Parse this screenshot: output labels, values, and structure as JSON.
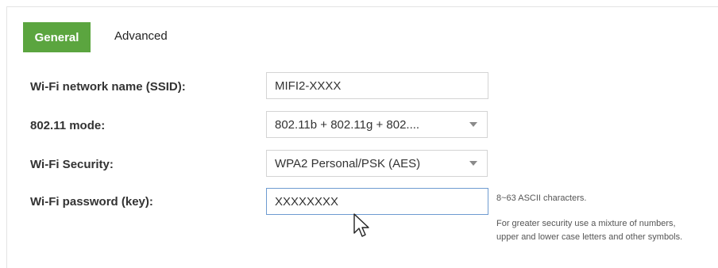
{
  "tabs": {
    "general": "General",
    "advanced": "Advanced"
  },
  "fields": {
    "ssid": {
      "label": "Wi-Fi network name (SSID):",
      "value": "MIFI2-XXXX"
    },
    "mode": {
      "label": "802.11 mode:",
      "value": "802.11b + 802.11g + 802...."
    },
    "security": {
      "label": "Wi-Fi Security:",
      "value": "WPA2 Personal/PSK (AES)"
    },
    "password": {
      "label": "Wi-Fi password (key):",
      "value": "XXXXXXXX",
      "hint_length": "8~63 ASCII characters.",
      "hint_security": "For greater security use a mixture of numbers, upper and lower case letters and other symbols."
    }
  },
  "colors": {
    "accent": "#5ba53f",
    "focus_border": "#6e9bd1"
  },
  "icons": {
    "select_caret": "chevron-down-icon",
    "pointer": "mouse-pointer-icon"
  }
}
